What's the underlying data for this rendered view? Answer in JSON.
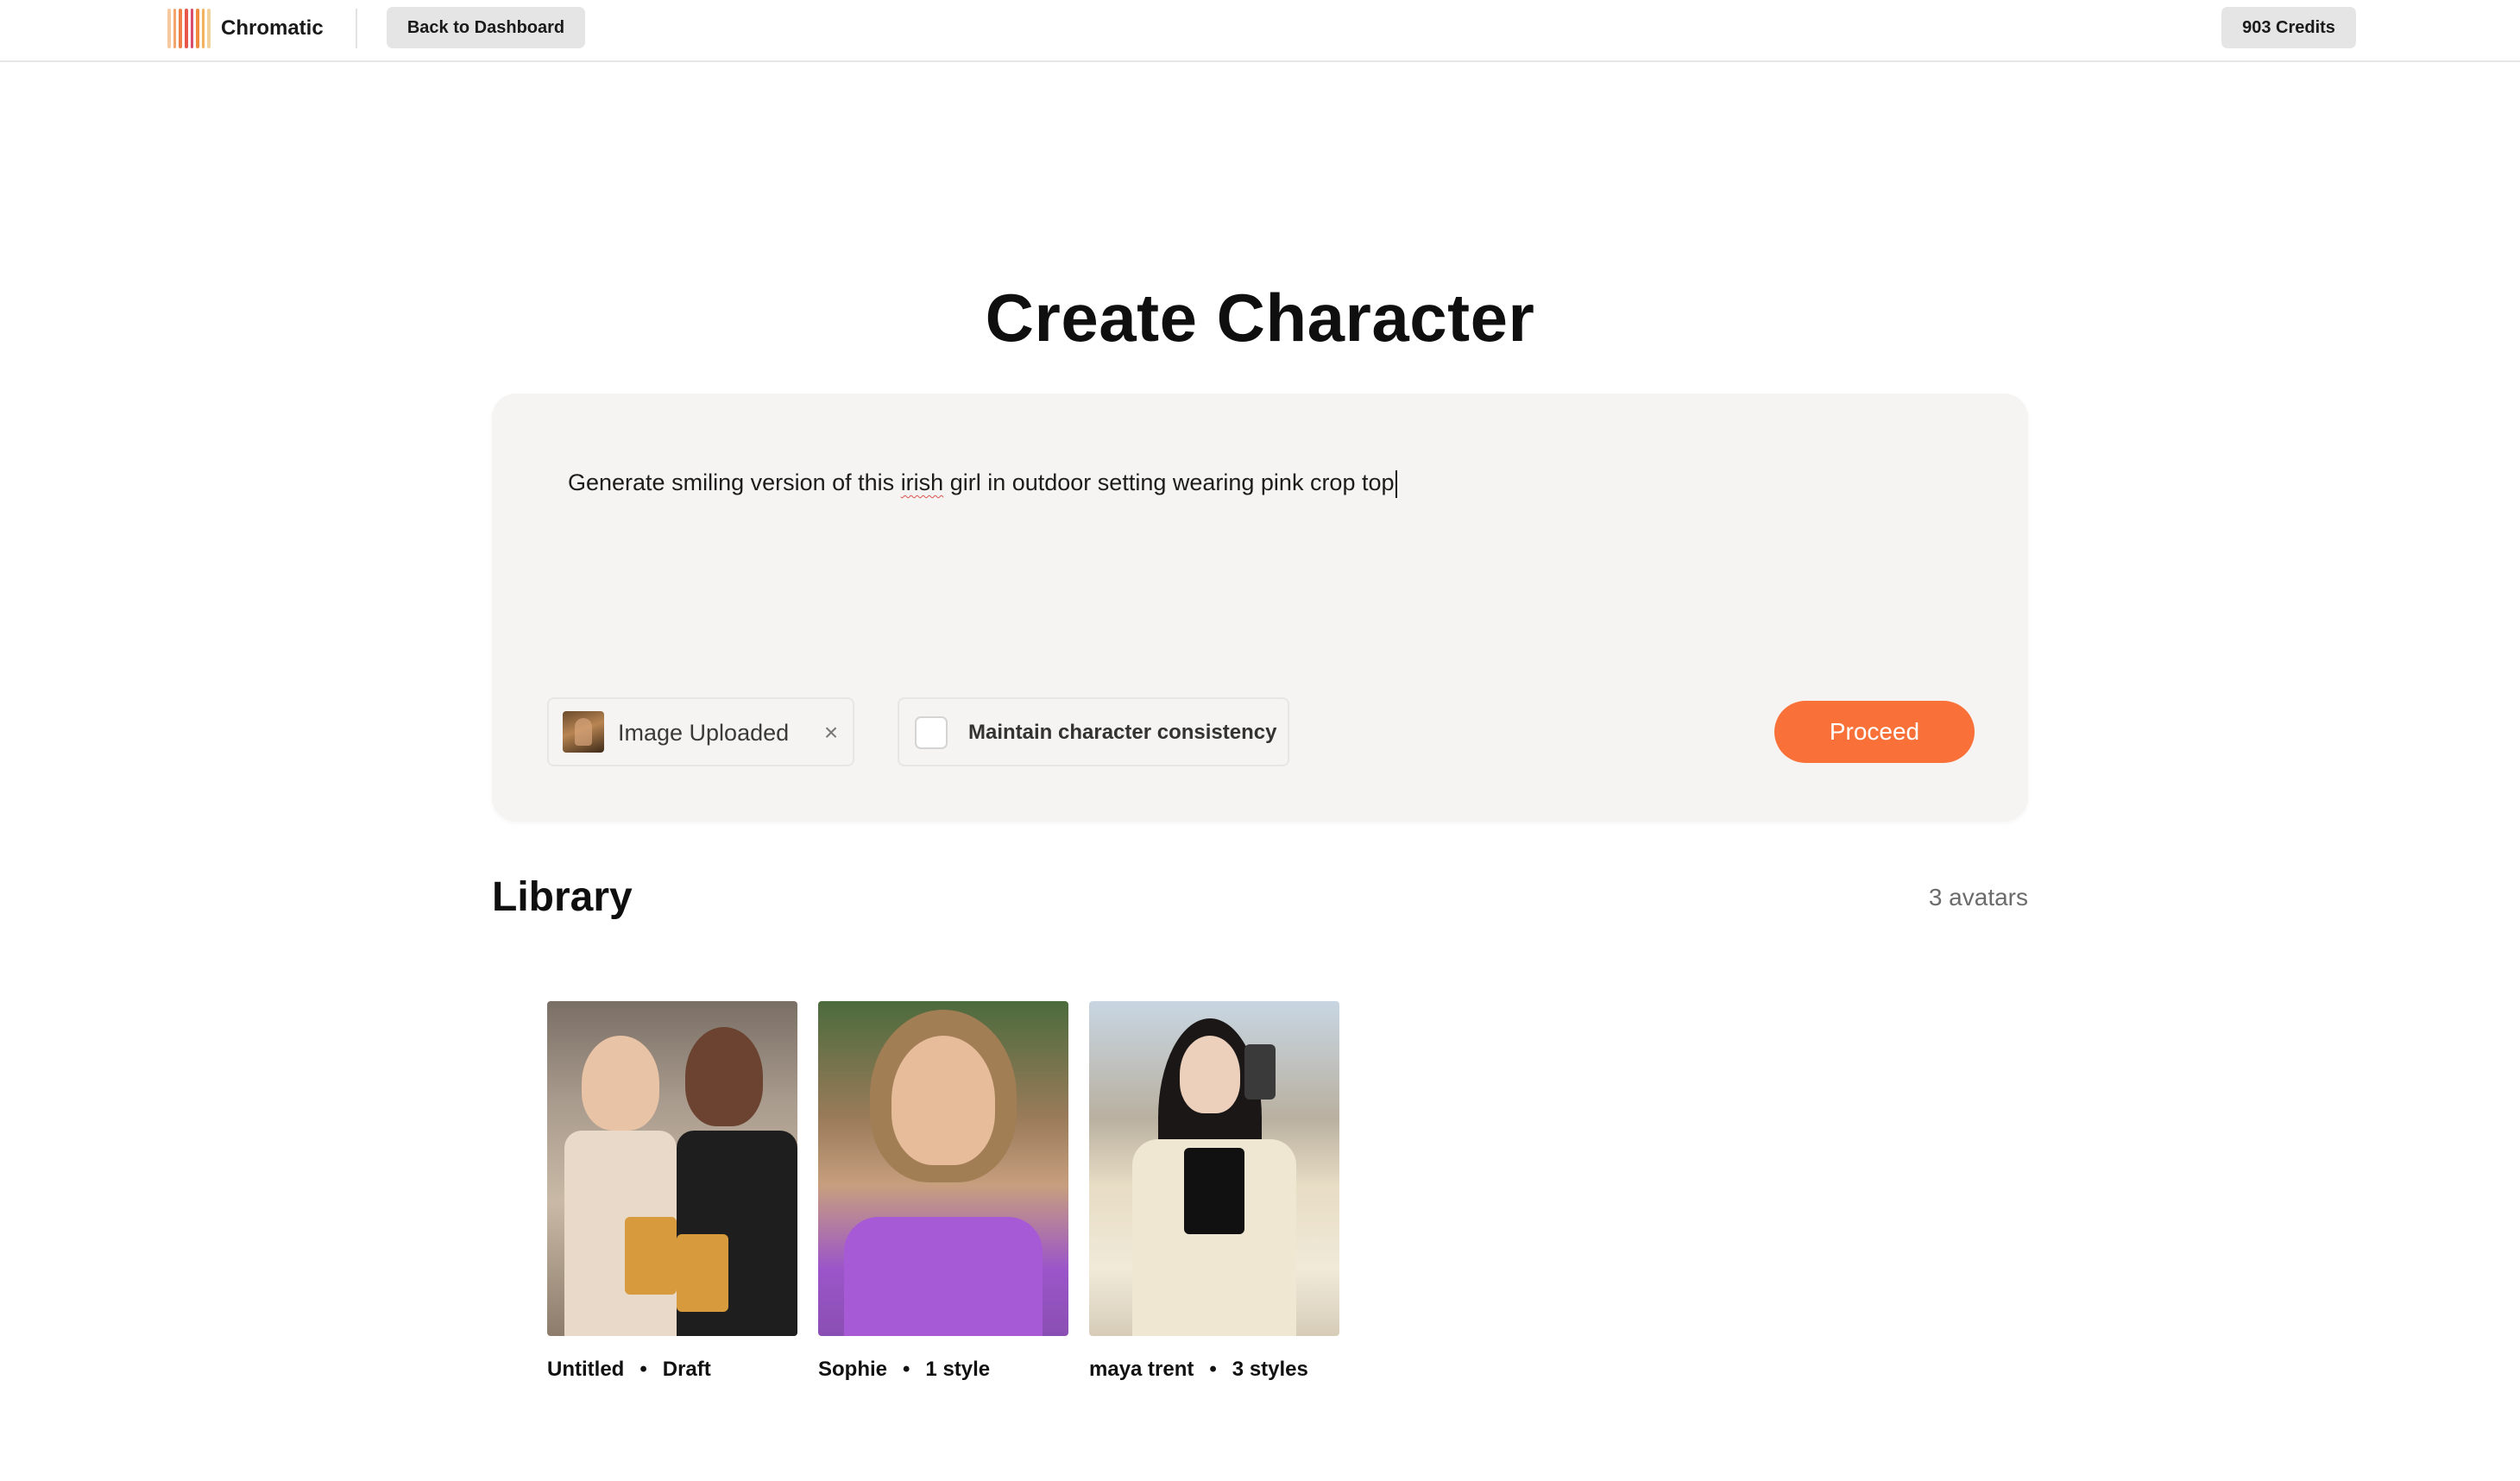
{
  "header": {
    "brand": "Chromatic",
    "back_label": "Back to Dashboard",
    "credits_label": "903 Credits",
    "logo_colors": [
      "#f6c9a0",
      "#f4a56e",
      "#f07f4a",
      "#e8564a",
      "#d94c6b",
      "#f08a3c",
      "#f5b25e",
      "#f3d19a"
    ]
  },
  "page_title": "Create Character",
  "composer": {
    "prompt_before": "Generate smiling version of this ",
    "prompt_misspelled": "irish",
    "prompt_after": " girl in outdoor setting wearing pink crop top",
    "upload_label": "Image Uploaded",
    "upload_close": "×",
    "consistency_label": "Maintain character consistency",
    "consistency_checked": false,
    "proceed_label": "Proceed",
    "accent_color": "#f97138"
  },
  "library": {
    "title": "Library",
    "count_label": "3 avatars",
    "items": [
      {
        "name": "Untitled",
        "meta": "Draft"
      },
      {
        "name": "Sophie",
        "meta": "1 style"
      },
      {
        "name": "maya trent",
        "meta": "3 styles"
      }
    ]
  }
}
